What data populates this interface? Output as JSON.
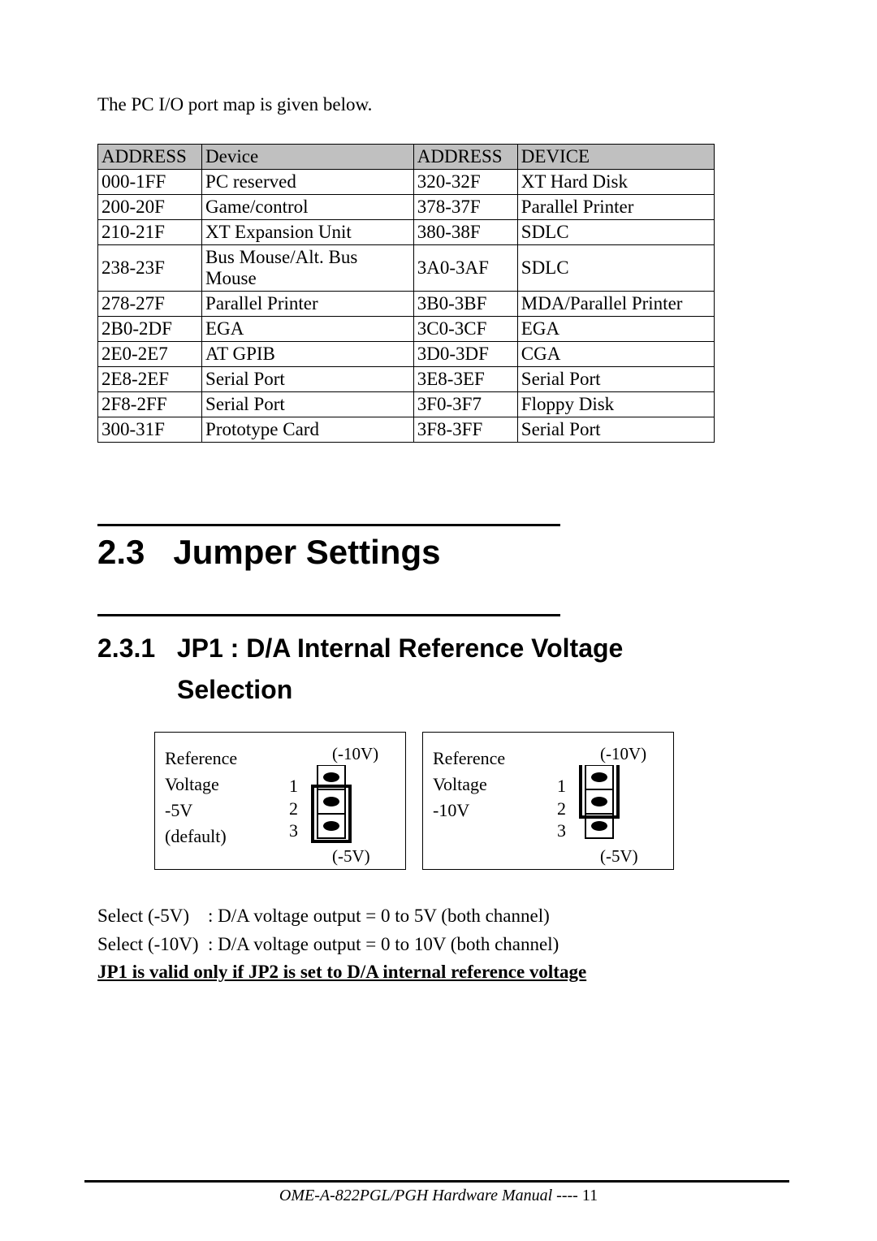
{
  "intro": "The PC I/O port map is given below.",
  "table": {
    "headers": [
      "ADDRESS",
      "Device",
      "ADDRESS",
      "DEVICE"
    ],
    "rows": [
      [
        "000-1FF",
        "PC reserved",
        "320-32F",
        "XT Hard Disk"
      ],
      [
        "200-20F",
        "Game/control",
        "378-37F",
        "Parallel Printer"
      ],
      [
        "210-21F",
        "XT Expansion Unit",
        "380-38F",
        "SDLC"
      ],
      [
        "238-23F",
        "Bus Mouse/Alt. Bus Mouse",
        "3A0-3AF",
        "SDLC"
      ],
      [
        "278-27F",
        "Parallel Printer",
        "3B0-3BF",
        "MDA/Parallel Printer"
      ],
      [
        "2B0-2DF",
        "EGA",
        "3C0-3CF",
        "EGA"
      ],
      [
        "2E0-2E7",
        "AT GPIB",
        "3D0-3DF",
        "CGA"
      ],
      [
        "2E8-2EF",
        "Serial Port",
        "3E8-3EF",
        "Serial Port"
      ],
      [
        "2F8-2FF",
        "Serial Port",
        "3F0-3F7",
        "Floppy Disk"
      ],
      [
        "300-31F",
        "Prototype Card",
        "3F8-3FF",
        "Serial Port"
      ]
    ]
  },
  "section": {
    "number": "2.3",
    "title": "Jumper Settings"
  },
  "subsection": {
    "number": "2.3.1",
    "title_line1": "JP1 : D/A Internal Reference Voltage",
    "title_line2": "Selection"
  },
  "jumpers": {
    "left": {
      "ref": "Reference",
      "volt": "Voltage",
      "val": "-5V",
      "def": "(default)",
      "top": "(-10V)",
      "bot": "(-5V)"
    },
    "right": {
      "ref": "Reference",
      "volt": "Voltage",
      "val": "-10V",
      "def": "",
      "top": "(-10V)",
      "bot": "(-5V)"
    },
    "nums": {
      "n1": "1",
      "n2": "2",
      "n3": "3"
    }
  },
  "notes": {
    "l1": "Select (-5V)    : D/A voltage output = 0 to 5V (both channel)",
    "l2": "Select (-10V)  : D/A voltage output = 0 to 10V (both channel)",
    "l3": "JP1 is valid only if JP2 is set to D/A internal reference voltage"
  },
  "footer": {
    "doc": "OME-A-822PGL/PGH Hardware Manual",
    "sep": "   ----",
    "page": " 11"
  }
}
